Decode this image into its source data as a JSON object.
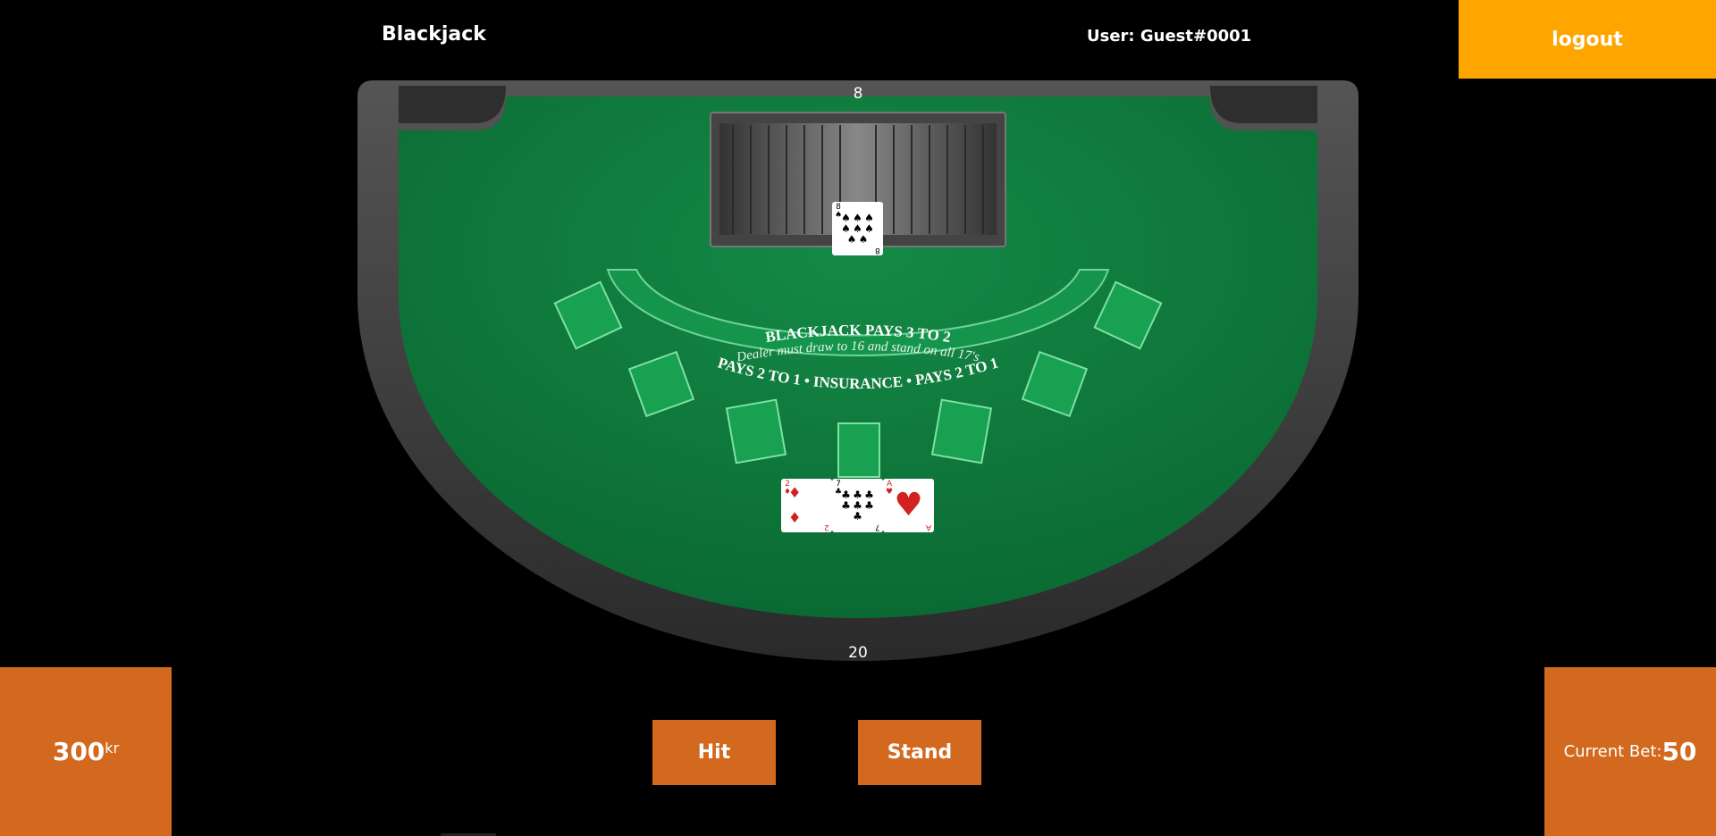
{
  "header": {
    "title": "Blackjack",
    "user": "User: Guest#0001",
    "logout_label": "logout"
  },
  "table": {
    "felt_color": "#0f7a3c",
    "rail_color": "#3a3a3a",
    "arc_line1": "BLACKJACK PAYS 3 TO 2",
    "arc_line2": "Dealer must draw to 16 and stand on all 17's",
    "arc_line3": "PAYS 2 TO 1  •  INSURANCE  •  PAYS 2 TO 1"
  },
  "dealer": {
    "count": "8",
    "cards": [
      {
        "rank": "8",
        "suit": "♠",
        "color": "black"
      }
    ]
  },
  "player": {
    "count": "20",
    "cards": [
      {
        "rank": "2",
        "suit": "♦",
        "color": "red"
      },
      {
        "rank": "7",
        "suit": "♣",
        "color": "black"
      },
      {
        "rank": "A",
        "suit": "♥",
        "color": "red"
      }
    ]
  },
  "balance": {
    "amount": "300",
    "unit": "kr"
  },
  "bet": {
    "label": "Current Bet:",
    "value": "50"
  },
  "actions": {
    "hit_label": "Hit",
    "stand_label": "Stand"
  },
  "colors": {
    "accent": "#ffa500",
    "panel": "#d2691e"
  }
}
